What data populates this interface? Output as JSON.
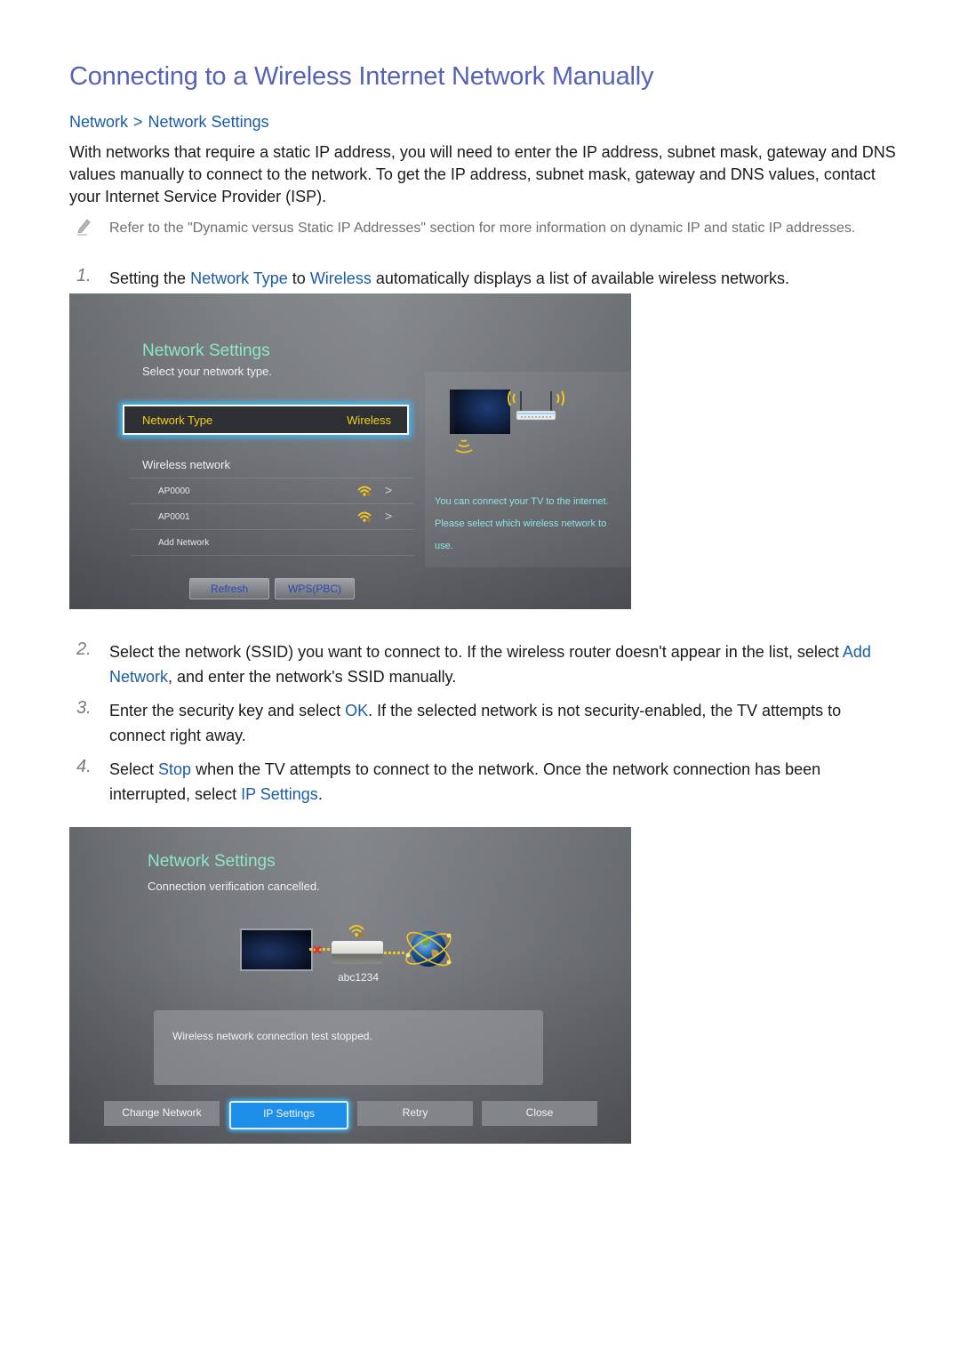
{
  "page": {
    "title": "Connecting to a Wireless Internet Network Manually",
    "breadcrumb": [
      "Network",
      "Network Settings"
    ],
    "intro": "With networks that require a static IP address, you will need to enter the IP address, subnet mask, gateway and DNS values manually to connect to the network. To get the IP address, subnet mask, gateway and DNS values, contact your Internet Service Provider (ISP).",
    "note": "Refer to the \"Dynamic versus Static IP Addresses\" section for more information on dynamic IP and static IP addresses.",
    "steps": [
      {
        "num": "1.",
        "parts": [
          "Setting the ",
          "Network Type",
          " to ",
          "Wireless",
          " automatically displays a list of available wireless networks."
        ]
      },
      {
        "num": "2.",
        "parts": [
          "Select the network (SSID) you want to connect to. If the wireless router doesn't appear in the list, select ",
          "Add Network",
          ", and enter the network's SSID manually."
        ]
      },
      {
        "num": "3.",
        "parts": [
          "Enter the security key and select ",
          "OK",
          ". If the selected network is not security-enabled, the TV attempts to connect right away."
        ]
      },
      {
        "num": "4.",
        "parts": [
          "Select ",
          "Stop",
          " when the TV attempts to connect to the network. Once the network connection has been interrupted, select ",
          "IP Settings",
          "."
        ]
      }
    ]
  },
  "screen1": {
    "title": "Network Settings",
    "subtitle": "Select your network type.",
    "network_type_label": "Network Type",
    "network_type_value": "Wireless",
    "wireless_header": "Wireless network",
    "networks": [
      {
        "name": "AP0000",
        "icon": "wifi-secured-icon",
        "has_arrow": true
      },
      {
        "name": "AP0001",
        "icon": "wifi-secured-icon",
        "has_arrow": true
      },
      {
        "name": "Add Network",
        "icon": null,
        "has_arrow": false
      }
    ],
    "buttons": [
      "Refresh",
      "WPS(PBC)"
    ],
    "info": "You can connect your TV to the internet. Please select which wireless network to use."
  },
  "screen2": {
    "title": "Network Settings",
    "subtitle": "Connection verification cancelled.",
    "ssid": "abc1234",
    "message": "Wireless network connection test stopped.",
    "buttons": [
      "Change Network",
      "IP Settings",
      "Retry",
      "Close"
    ],
    "selected_button": "IP Settings"
  },
  "colors": {
    "title": "#5562b8",
    "link": "#1a5ca8",
    "tv_heading": "#8ee6c4",
    "tv_highlight": "#f3d21a",
    "tv_focus": "#3cb8ff",
    "tv_info": "#8fe3e8"
  }
}
